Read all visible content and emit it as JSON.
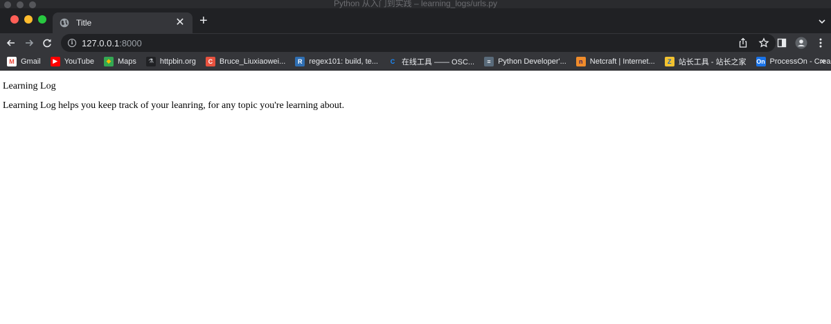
{
  "window": {
    "title": "Python 从入门到实践 – learning_logs/urls.py"
  },
  "tab": {
    "title": "Title",
    "close_glyph": "✕",
    "new_tab_glyph": "+"
  },
  "address_bar": {
    "host": "127.0.0.1",
    "port": ":8000"
  },
  "bookmarks": {
    "items": [
      {
        "label": "Gmail",
        "icon": "gmail-icon",
        "glyph": "M",
        "color": "#ffffff",
        "fg": "#ea4335"
      },
      {
        "label": "YouTube",
        "icon": "youtube-icon",
        "glyph": "▶",
        "color": "#ff0000",
        "fg": "#ffffff"
      },
      {
        "label": "Maps",
        "icon": "maps-icon",
        "glyph": "◆",
        "color": "#34a853",
        "fg": "#fbbc04"
      },
      {
        "label": "httpbin.org",
        "icon": "httpbin-icon",
        "glyph": "⚗",
        "color": "#202124",
        "fg": "#bdc1c6"
      },
      {
        "label": "Bruce_Liuxiaowei...",
        "icon": "csdn-icon",
        "glyph": "C",
        "color": "#e8523f",
        "fg": "#ffffff"
      },
      {
        "label": "regex101: build, te...",
        "icon": "regex101-icon",
        "glyph": "R",
        "color": "#2f6fb3",
        "fg": "#ffffff"
      },
      {
        "label": "在线工具 —— OSC...",
        "icon": "oschina-icon",
        "glyph": "C",
        "color": "#35363a",
        "fg": "#1a8cff"
      },
      {
        "label": "Python Developer'...",
        "icon": "python-docs-icon",
        "glyph": "≡",
        "color": "#5a6b7b",
        "fg": "#ffffff"
      },
      {
        "label": "Netcraft | Internet...",
        "icon": "netcraft-icon",
        "glyph": "n",
        "color": "#f08c2b",
        "fg": "#3a1f5d"
      },
      {
        "label": "站长工具 - 站长之家",
        "icon": "chinaz-icon",
        "glyph": "Z",
        "color": "#f2c230",
        "fg": "#1d5fb8"
      },
      {
        "label": "ProcessOn - Crea...",
        "icon": "processon-icon",
        "glyph": "On",
        "color": "#1a73e8",
        "fg": "#ffffff"
      }
    ],
    "overflow_glyph": "»"
  },
  "page": {
    "heading": "Learning Log",
    "description": "Learning Log helps you keep track of your leanring, for any topic you're learning about."
  }
}
